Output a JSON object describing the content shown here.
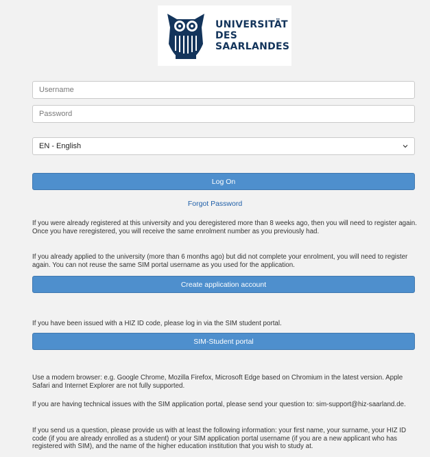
{
  "logo": {
    "line1": "UNIVERSITÄT",
    "line2": "DES",
    "line3": "SAARLANDES",
    "color": "#13345b"
  },
  "form": {
    "username_placeholder": "Username",
    "password_placeholder": "Password",
    "language_selected": "EN - English",
    "login_label": "Log On",
    "forgot_label": "Forgot Password"
  },
  "texts": {
    "reregister": "If you were already registered at this university and you deregistered more than 8 weeks ago, then you will need to register again. Once you have reregistered, you will receive the same enrolment number as you previously had.",
    "applied": "If you already applied to the university (more than 6 months ago) but did not complete your enrolment, you will need to register again. You can not reuse the same SIM portal username as you used for the application.",
    "create_label": "Create application account",
    "hiz": "If you have been issued with a HIZ ID code, please log in via the SIM student portal.",
    "sim_label": "SIM-Student portal",
    "browser": "Use a modern browser: e.g. Google Chrome, Mozilla Firefox, Microsoft Edge based on Chromium in the latest version. Apple Safari and Internet Explorer are not fully supported.",
    "support": "If you are having technical issues with the SIM application portal, please send your question to: sim-support@hiz-saarland.de.",
    "question": "If you send us a question, please provide us with at least the following information: your first name, your surname, your HIZ ID code (if you are already enrolled as a student) or your SIM application portal username (if you are a new applicant who has registered with SIM), and the name of the higher education institution that you wish to study at."
  },
  "colors": {
    "button": "#4e8fcd",
    "link": "#1f5fa8",
    "background": "#f2f2f2"
  }
}
